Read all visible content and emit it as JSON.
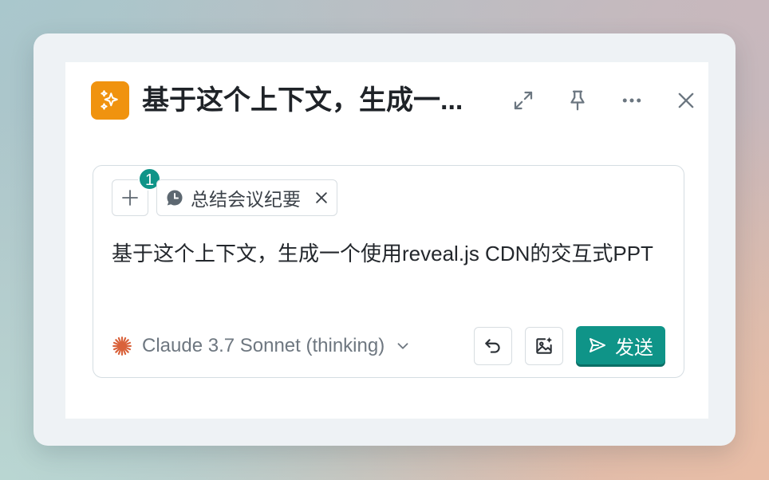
{
  "colors": {
    "accent": "#0f9488",
    "app_icon_bg": "#f0930f",
    "claude_icon": "#d9623b"
  },
  "header": {
    "title": "基于这个上下文，生成一...",
    "icons": [
      "sparkles-icon",
      "expand-icon",
      "pin-icon",
      "more-icon",
      "close-icon"
    ]
  },
  "context": {
    "count": "1",
    "chip_label": "总结会议纪要",
    "chip_icon": "clock-icon"
  },
  "prompt": {
    "text": "基于这个上下文，生成一个使用reveal.js CDN的交互式PPT"
  },
  "footer": {
    "model_label": "Claude 3.7 Sonnet (thinking)",
    "send_label": "发送",
    "icons": [
      "claude-icon",
      "chevron-down-icon",
      "undo-icon",
      "image-icon",
      "send-icon"
    ]
  }
}
